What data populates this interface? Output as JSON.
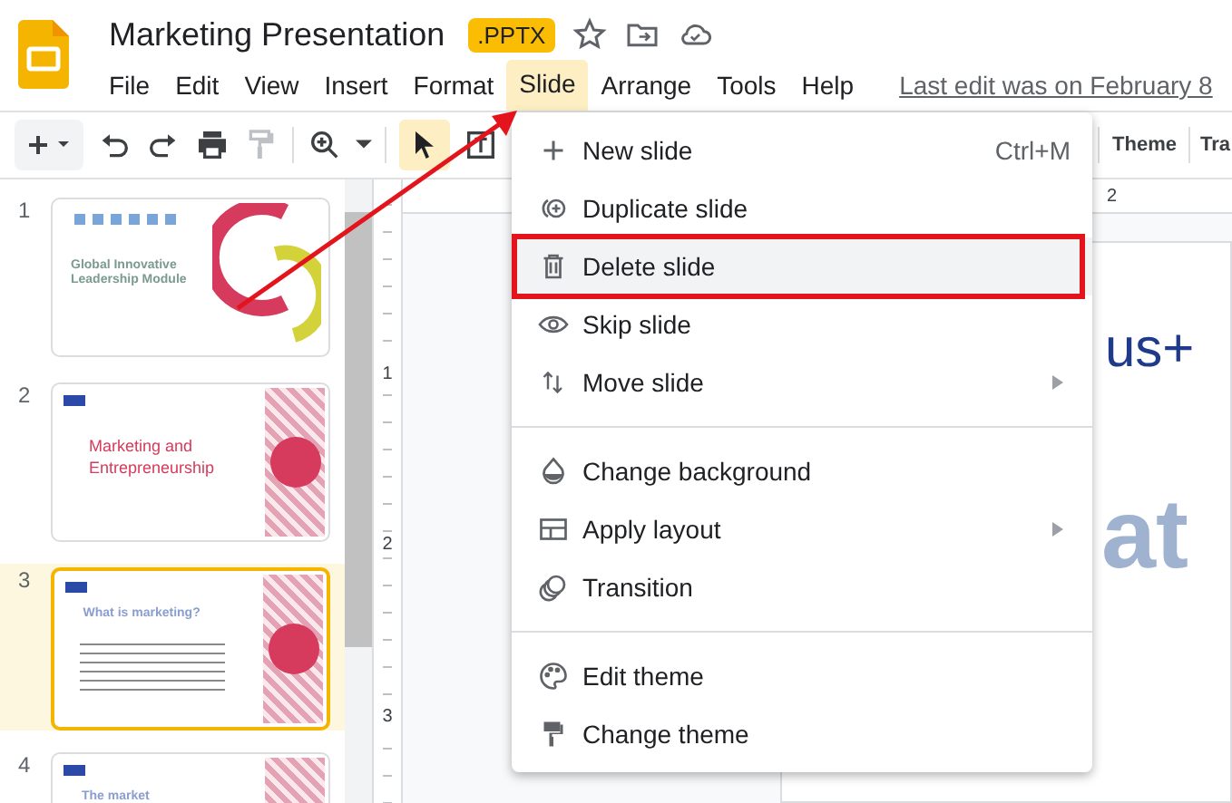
{
  "app": {
    "title": "Marketing Presentation",
    "badge": ".PPTX",
    "last_edit": "Last edit was on February 8"
  },
  "menubar": [
    {
      "label": "File",
      "selected": false
    },
    {
      "label": "Edit",
      "selected": false
    },
    {
      "label": "View",
      "selected": false
    },
    {
      "label": "Insert",
      "selected": false
    },
    {
      "label": "Format",
      "selected": false
    },
    {
      "label": "Slide",
      "selected": true
    },
    {
      "label": "Arrange",
      "selected": false
    },
    {
      "label": "Tools",
      "selected": false
    },
    {
      "label": "Help",
      "selected": false
    }
  ],
  "toolbar": {
    "right_buttons": [
      "Theme",
      "Tra"
    ]
  },
  "rulers": {
    "horizontal": [
      "2"
    ],
    "vertical": [
      "1",
      "2",
      "3"
    ]
  },
  "slides": [
    {
      "number": "1",
      "selected": false,
      "kind": "cover",
      "title": "Global Innovative Leadership Module"
    },
    {
      "number": "2",
      "selected": false,
      "kind": "section",
      "title": "Marketing and Entrepreneurship"
    },
    {
      "number": "3",
      "selected": true,
      "kind": "content",
      "title": "What is marketing?"
    },
    {
      "number": "4",
      "selected": false,
      "kind": "content",
      "title": "The market"
    }
  ],
  "canvas": {
    "texts": [
      "us+",
      "at"
    ]
  },
  "slide_menu": {
    "groups": [
      [
        {
          "label": "New slide",
          "shortcut": "Ctrl+M",
          "submenu": false,
          "highlighted": false
        },
        {
          "label": "Duplicate slide",
          "submenu": false,
          "highlighted": false
        },
        {
          "label": "Delete slide",
          "submenu": false,
          "highlighted": true
        },
        {
          "label": "Skip slide",
          "submenu": false,
          "highlighted": false
        },
        {
          "label": "Move slide",
          "submenu": true,
          "highlighted": false
        }
      ],
      [
        {
          "label": "Change background",
          "submenu": false,
          "highlighted": false
        },
        {
          "label": "Apply layout",
          "submenu": true,
          "highlighted": false
        },
        {
          "label": "Transition",
          "submenu": false,
          "highlighted": false
        }
      ],
      [
        {
          "label": "Edit theme",
          "submenu": false,
          "highlighted": false
        },
        {
          "label": "Change theme",
          "submenu": false,
          "highlighted": false
        }
      ]
    ]
  }
}
